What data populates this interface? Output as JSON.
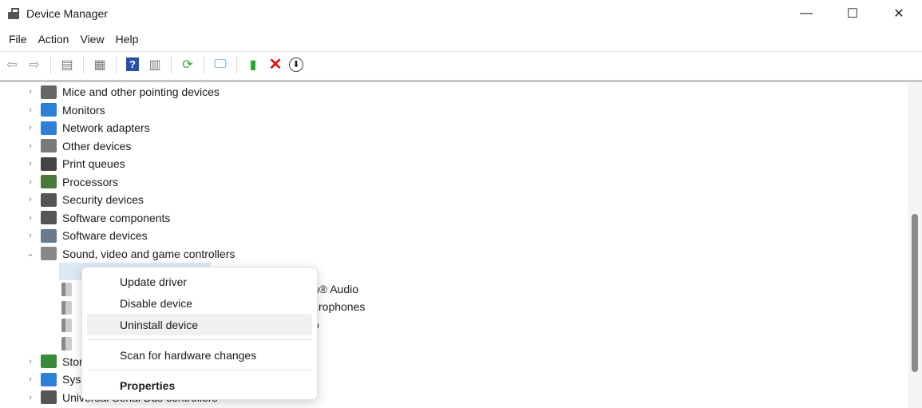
{
  "window": {
    "title": "Device Manager",
    "minimize": "—",
    "maximize": "☐",
    "close": "✕"
  },
  "menu": [
    "File",
    "Action",
    "View",
    "Help"
  ],
  "toolbar": [
    "back-icon",
    "forward-icon",
    "console-tree-icon",
    "properties-icon",
    "help-icon",
    "action-pane-icon",
    "update-driver-icon",
    "scan-hardware-icon",
    "add-driver-icon",
    "uninstall-icon",
    "disable-icon"
  ],
  "tree": {
    "categories": [
      {
        "label": "Mice and other pointing devices",
        "icon": "mouse-icon",
        "color": "#666666"
      },
      {
        "label": "Monitors",
        "icon": "monitor-icon",
        "color": "#2f7fd6"
      },
      {
        "label": "Network adapters",
        "icon": "network-icon",
        "color": "#2f7fd6"
      },
      {
        "label": "Other devices",
        "icon": "other-devices-icon",
        "color": "#7a7a7a"
      },
      {
        "label": "Print queues",
        "icon": "printer-icon",
        "color": "#444444"
      },
      {
        "label": "Processors",
        "icon": "processor-icon",
        "color": "#4a7a3a"
      },
      {
        "label": "Security devices",
        "icon": "security-icon",
        "color": "#555555"
      },
      {
        "label": "Software components",
        "icon": "software-components-icon",
        "color": "#555555"
      },
      {
        "label": "Software devices",
        "icon": "software-devices-icon",
        "color": "#6a7a8a"
      },
      {
        "label": "Sound, video and game controllers",
        "icon": "speaker-icon",
        "color": "#888888",
        "expanded": true
      }
    ],
    "child_fragments": [
      "n® Audio",
      "crophones",
      "o"
    ],
    "after": [
      {
        "label": "Stor",
        "icon": "storage-icon",
        "color": "#3a8a3a"
      },
      {
        "label": "Syst",
        "icon": "system-icon",
        "color": "#2f7fd6"
      },
      {
        "label": "Universal Serial Bus controllers",
        "icon": "usb-icon",
        "color": "#555555"
      }
    ]
  },
  "context_menu": {
    "items": [
      "Update driver",
      "Disable device",
      "Uninstall device",
      "Scan for hardware changes",
      "Properties"
    ],
    "highlighted": "Uninstall device"
  }
}
